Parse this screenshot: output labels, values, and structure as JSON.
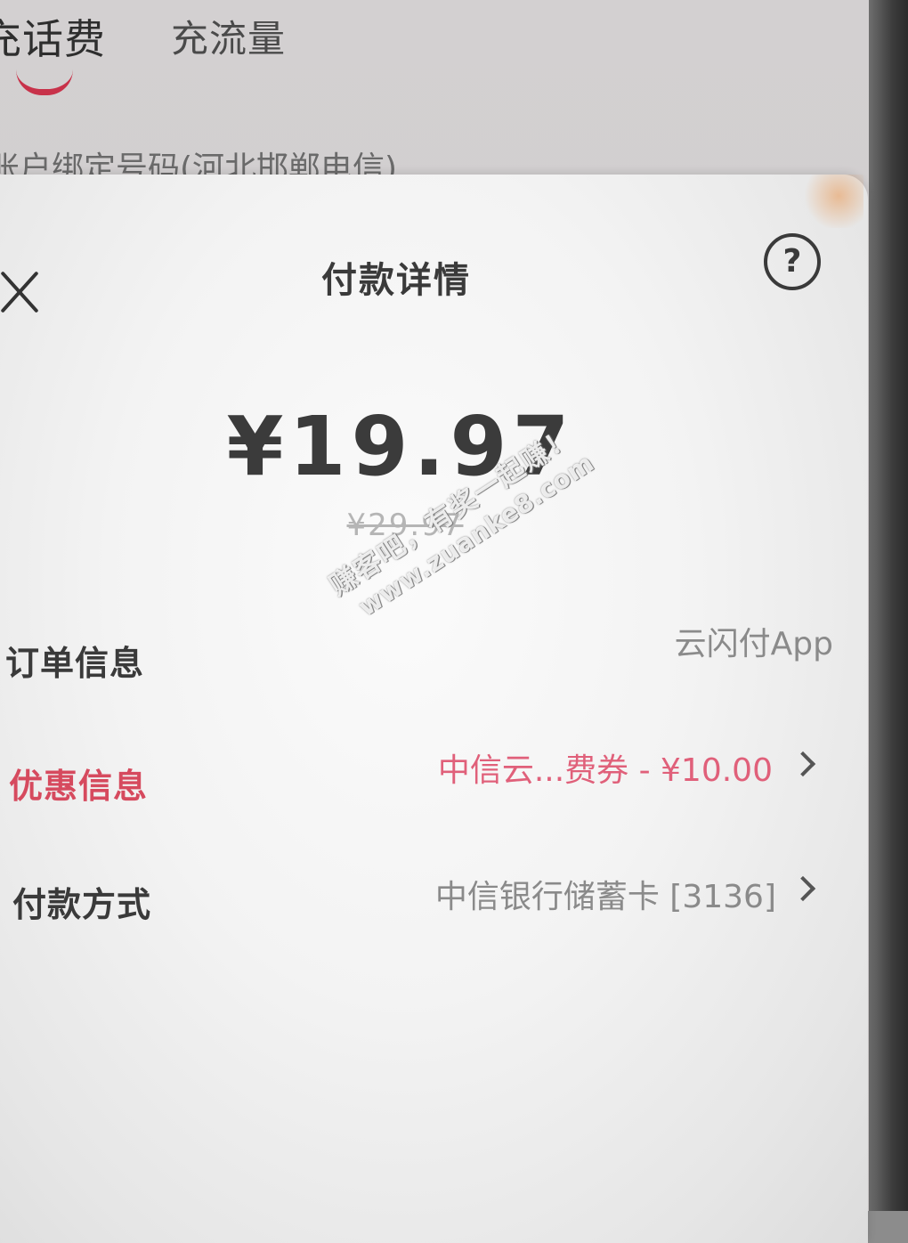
{
  "background": {
    "tabs": [
      {
        "label": "充话费",
        "active": true
      },
      {
        "label": "充流量",
        "active": false
      }
    ],
    "subtitle": "账户绑定号码(河北邯郸电信)"
  },
  "sheet": {
    "title": "付款详情",
    "close_icon": "close-icon",
    "help_icon": "question-circle-icon",
    "help_glyph": "?",
    "amount": "¥19.97",
    "original_amount": "¥29.97",
    "rows": [
      {
        "label": "订单信息",
        "value": "云闪付App",
        "has_chevron": false
      },
      {
        "label": "优惠信息",
        "value": "中信云...费券 - ¥10.00",
        "has_chevron": true
      },
      {
        "label": "付款方式",
        "value": "中信银行储蓄卡 [3136]",
        "has_chevron": true
      }
    ]
  },
  "watermark": {
    "line1": "赚客吧，有奖一起赚！",
    "line2": "www.zuanke8.com"
  },
  "colors": {
    "accent_red": "#d64a5e",
    "promo_text": "#e0607a",
    "text_primary": "#3a3a3a",
    "text_muted": "#8a8a8a"
  }
}
